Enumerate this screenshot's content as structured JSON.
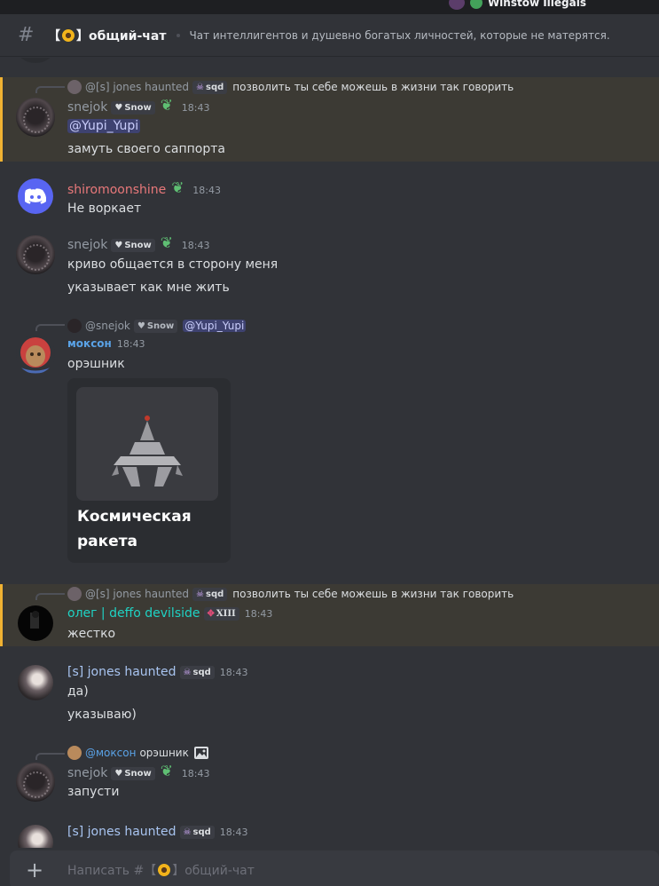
{
  "top_user": "Winstow Illegals",
  "channel": {
    "hash": "#",
    "name_prefix": "【",
    "name_suffix": "】общий-чат",
    "topic": "Чат интеллигентов и душевно богатых личностей, которые не матерятся."
  },
  "messages": {
    "m1": {
      "reply_author": "@[s] jones haunted",
      "reply_tag": "sqd",
      "reply_text": "позволить ты себе можешь в жизни так говорить",
      "author": "snejok",
      "author_color": "#949ba4",
      "tag": "Snow",
      "time": "18:43",
      "lines": [
        "@Yupi_Yupi",
        "замуть своего саппорта"
      ]
    },
    "m2": {
      "author": "shiromoonshine",
      "author_color": "#e8787a",
      "time": "18:43",
      "lines": [
        "Не воркает"
      ]
    },
    "m3": {
      "author": "snejok",
      "tag": "Snow",
      "time": "18:43",
      "lines": [
        "криво общается в сторону меня",
        "указывает как мне жить"
      ]
    },
    "m4": {
      "reply_author": "@snejok",
      "reply_tag": "Snow",
      "reply_mention": "@Yupi_Yupi",
      "author": "моксон",
      "author_color": "#5aa2e6",
      "time": "18:43",
      "lines": [
        "орэшник"
      ],
      "card_title": "Космическая ракета"
    },
    "m5": {
      "reply_author": "@[s] jones haunted",
      "reply_tag": "sqd",
      "reply_text": "позволить ты себе можешь в жизни так говорить",
      "author": "олег | deffo devilside",
      "author_color": "#1fd3c4",
      "tag": "XIII",
      "time": "18:43",
      "lines": [
        "жестко"
      ]
    },
    "m6": {
      "author": "[s] jones haunted",
      "author_color": "#a8c4f0",
      "tag": "sqd",
      "time": "18:43",
      "lines": [
        "да)",
        "указываю)"
      ]
    },
    "m7": {
      "reply_author": "@моксон",
      "reply_text": "орэшник",
      "author": "snejok",
      "tag": "Snow",
      "time": "18:43",
      "lines": [
        "запусти"
      ]
    },
    "m8": {
      "author": "[s] jones haunted",
      "tag": "sqd",
      "time": "18:43"
    }
  },
  "composer": {
    "plus": "+",
    "placeholder_prefix": "Написать #【",
    "placeholder_suffix": "】общий-чат"
  }
}
